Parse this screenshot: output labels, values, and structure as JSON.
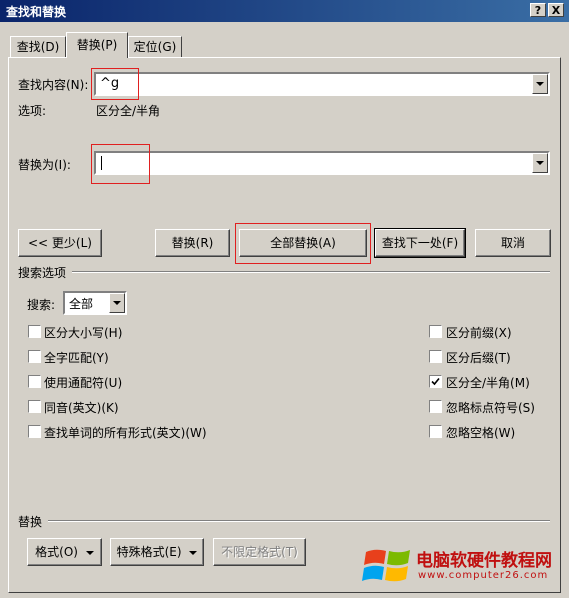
{
  "window": {
    "title": "查找和替换",
    "help_btn": "?",
    "close_btn": "X"
  },
  "tabs": [
    {
      "label": "查找(D)"
    },
    {
      "label": "替换(P)"
    },
    {
      "label": "定位(G)"
    }
  ],
  "find": {
    "label": "查找内容(N):",
    "value": "^g"
  },
  "options": {
    "label": "选项:",
    "value": "区分全/半角"
  },
  "replace": {
    "label": "替换为(I):",
    "value": ""
  },
  "buttons": {
    "less": "<< 更少(L)",
    "replace": "替换(R)",
    "replace_all": "全部替换(A)",
    "find_next": "查找下一处(F)",
    "cancel": "取消"
  },
  "search_options": {
    "heading": "搜索选项",
    "search_label": "搜索:",
    "search_value": "全部",
    "left": [
      {
        "label": "区分大小写(H)",
        "checked": false
      },
      {
        "label": "全字匹配(Y)",
        "checked": false
      },
      {
        "label": "使用通配符(U)",
        "checked": false
      },
      {
        "label": "同音(英文)(K)",
        "checked": false
      },
      {
        "label": "查找单词的所有形式(英文)(W)",
        "checked": false
      }
    ],
    "right": [
      {
        "label": "区分前缀(X)",
        "checked": false
      },
      {
        "label": "区分后缀(T)",
        "checked": false
      },
      {
        "label": "区分全/半角(M)",
        "checked": true
      },
      {
        "label": "忽略标点符号(S)",
        "checked": false
      },
      {
        "label": "忽略空格(W)",
        "checked": false
      }
    ]
  },
  "replace_section": {
    "heading": "替换",
    "format": "格式(O)",
    "special": "特殊格式(E)",
    "no_format": "不限定格式(T)"
  },
  "watermark": {
    "name": "电脑软硬件教程网",
    "url": "www.computer26.com"
  },
  "colors": {
    "highlight": "#e02020",
    "title_bg": "#0a246a",
    "dialog_bg": "#d4d0c8"
  }
}
